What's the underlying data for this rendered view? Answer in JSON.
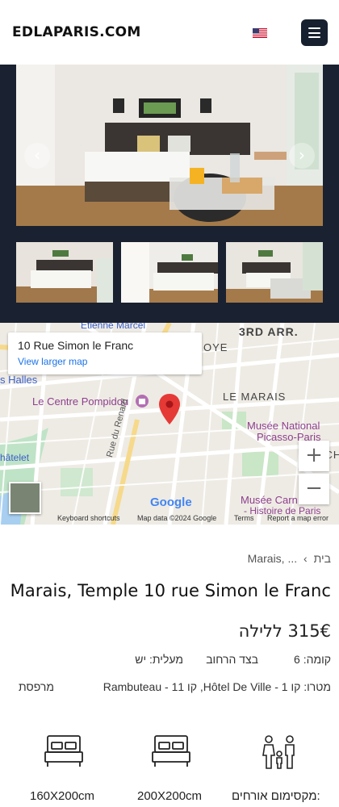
{
  "header": {
    "logo": "EDLAPARIS.COM",
    "language_flag": "us-flag-icon",
    "menu_icon": "hamburger-menu-icon"
  },
  "gallery": {
    "prev_label": "‹",
    "next_label": "›"
  },
  "map": {
    "place_name": "10 Rue Simon le Franc",
    "larger_map_link": "View larger map",
    "zoom_in": "+",
    "zoom_out": "−",
    "brand": "Google",
    "footer": {
      "shortcuts": "Keyboard shortcuts",
      "map_data": "Map data ©2024 Google",
      "terms": "Terms",
      "report": "Report a map error"
    },
    "labels": {
      "etienne": "Étienne Marcel",
      "arr": "3RD ARR.",
      "oye": "OYE",
      "halles": "s Halles",
      "pompidou": "Le Centre Pompidou",
      "marais": "LE MARAIS",
      "picasso_1": "Musée National",
      "picasso_2": "Picasso-Paris",
      "lech": "LE CH",
      "chatelet": "hâtelet",
      "renard": "Rue du Renard",
      "carnavalet_1": "Musée Carn",
      "carnavalet_2": "- Histoire de Paris"
    }
  },
  "listing": {
    "breadcrumb_home": "בית",
    "breadcrumb_separator": "›",
    "breadcrumb_current": "Marais, ...",
    "title": "Marais, Temple 10 rue Simon le Franc",
    "price": "315€ ללילה",
    "floor": "קומה: 6",
    "side": "בצד הרחוב",
    "elevator": "מעלית: יש",
    "metro": "מטרו: קו 1 - Hôtel De Ville, קו 11 - Rambuteau",
    "balcony": "מרפסת",
    "features": [
      {
        "icon": "family-guests-icon",
        "label": "מקסימום אורחים:"
      },
      {
        "icon": "double-bed-icon",
        "label": "200X200cm"
      },
      {
        "icon": "double-bed-icon",
        "label": "160X200cm"
      }
    ]
  }
}
